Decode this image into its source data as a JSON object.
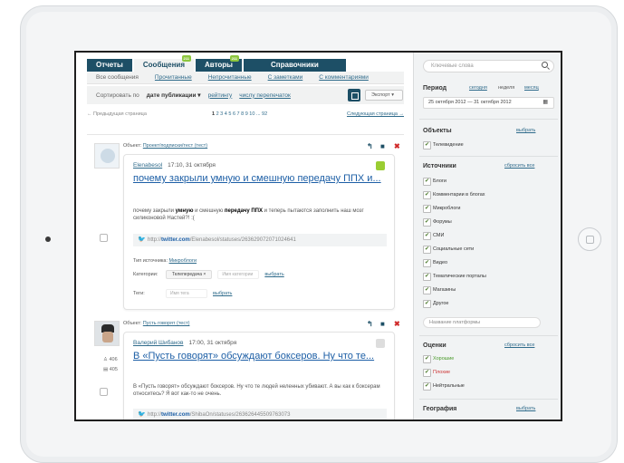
{
  "tabs": [
    {
      "label": "Отчеты",
      "badge": ""
    },
    {
      "label": "Сообщения",
      "badge": "211"
    },
    {
      "label": "Авторы",
      "badge": "211"
    },
    {
      "label": "Справочники",
      "badge": ""
    }
  ],
  "subnav": {
    "all": "Все сообщения",
    "read": "Прочитанные",
    "unread": "Непрочитанные",
    "notes": "С заметками",
    "comments": "С комментариями"
  },
  "sort": {
    "label": "Сортировать по",
    "selected": "дате публикации ▾",
    "by_rating": "рейтингу",
    "by_reposts": "числу перепечаток",
    "export": "Экспорт ▾"
  },
  "pager": {
    "prev": "← Предыдущая страница",
    "current": "1",
    "pages": "2 3 4 5 6 7 8 9 10 ... 92",
    "next": "Следующая страница →"
  },
  "posts": [
    {
      "object_label": "Объект:",
      "object_link": "Проект/подписки/тест (тест)",
      "author": "Elenabesol",
      "time": "17:10, 31 октября",
      "status_color": "#9acd32",
      "title": "почему закрыли умную и смешную передачу ППХ и...",
      "body_start": "почему закрыли ",
      "body_hl1": "умную",
      "body_mid": " и смешную ",
      "body_hl2": "передачу ППХ",
      "body_end": " и теперь пытаются заполнить наш мозг силиконовой Настей?! :(",
      "url_prefix": "http://",
      "url_domain": "twitter.com",
      "url_path": "/Elenabesol/statuses/263629072071024641",
      "source_label": "Тип источника:",
      "source_value": "Микроблоги",
      "category_label": "Категории:",
      "category_chip": "Телепередача ×",
      "category_placeholder": "Имя категории",
      "category_action": "выбрать",
      "tags_label": "Теги:",
      "tags_placeholder": "Имя тега",
      "tags_action": "выбрать"
    },
    {
      "object_label": "Объект:",
      "object_link": "Пусть говорят (тест)",
      "author": "Валерий Шибанов",
      "time": "17:00, 31 октября",
      "status_color": "#dddddd",
      "title": "В «Пусть говорят» обсуждают боксеров. Ну что те...",
      "body": "В «Пусть говорят» обсуждают боксеров. Ну что те людей неленных убивают. А вы как к боксерам относитесь? Я вот как-то не очень.",
      "followers": "406",
      "posts_count": "405",
      "url_prefix": "http://",
      "url_domain": "twitter.com",
      "url_path": "/ShibaOn/statuses/263626445509763073"
    }
  ],
  "side": {
    "search_placeholder": "Ключевые слова",
    "period": {
      "title": "Период",
      "today": "сегодня",
      "week": "неделя",
      "month": "месяц",
      "range": "25 октября 2012 — 31 октября 2012"
    },
    "objects": {
      "title": "Объекты",
      "action": "выбрать",
      "items": [
        "Телевидение"
      ]
    },
    "sources": {
      "title": "Источники",
      "action": "сбросить все",
      "items": [
        "Блоги",
        "Комментарии в блогах",
        "Микроблоги",
        "Форумы",
        "СМИ",
        "Социальные сети",
        "Видео",
        "Тематические порталы",
        "Магазины",
        "Другое"
      ],
      "platform_placeholder": "Название платформы"
    },
    "ratings": {
      "title": "Оценки",
      "action": "сбросить все",
      "items": [
        "Хорошие",
        "Плохие",
        "Нейтральные"
      ]
    },
    "geo": {
      "title": "География",
      "action": "выбрать"
    }
  }
}
